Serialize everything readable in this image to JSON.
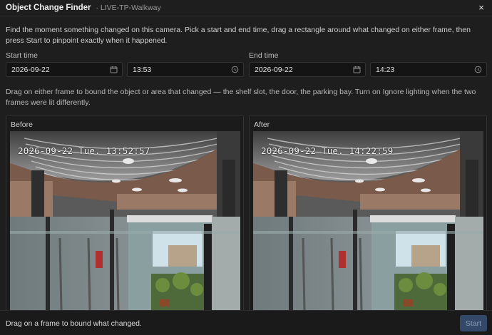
{
  "window": {
    "title": "Object Change Finder",
    "subtitle": "· LIVE-TP-Walkway",
    "close_glyph": "×"
  },
  "intro": "Find the moment something changed on this camera. Pick a start and end time, drag a rectangle around what changed on either frame, then press Start to pinpoint exactly when it happened.",
  "start": {
    "label": "Start time",
    "date": "2026-09-22",
    "time": "13:53"
  },
  "end": {
    "label": "End time",
    "date": "2026-09-22",
    "time": "14:23"
  },
  "note": "Drag on either frame to bound the object or area that changed — the shelf slot, the door, the parking bay. Turn on Ignore lighting when the two frames were lit differently.",
  "before": {
    "label": "Before",
    "osd": "2026-09-22 Tue. 13:52:57"
  },
  "after": {
    "label": "After",
    "osd": "2026-09-22 Tue. 14:22:59"
  },
  "footer": {
    "status": "Drag on a frame to bound what changed.",
    "start_label": "Start"
  },
  "icons": {
    "date": "calendar-icon",
    "time": "clock-icon",
    "close": "close-icon"
  },
  "colors": {
    "background": "#1e1e1e",
    "input_bg": "#141414",
    "button_disabled": "#34496a"
  }
}
